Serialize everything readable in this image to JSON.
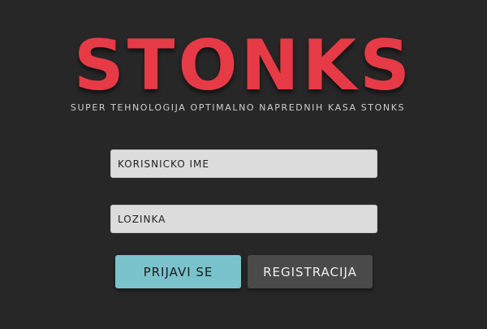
{
  "app": {
    "title": "STONKS",
    "tagline": "Super Tehnologija Optimalno Naprednih Kasa Stonks"
  },
  "form": {
    "username_placeholder": "Korisnicko ime",
    "username_value": "",
    "password_placeholder": "Lozinka",
    "password_value": "",
    "login_label": "Prijavi se",
    "register_label": "Registracija"
  },
  "colors": {
    "background": "#272727",
    "logo": "#e63b46",
    "login_button": "#7ac3cc",
    "register_button": "#4a4a4a",
    "field": "#dcdcdc"
  }
}
